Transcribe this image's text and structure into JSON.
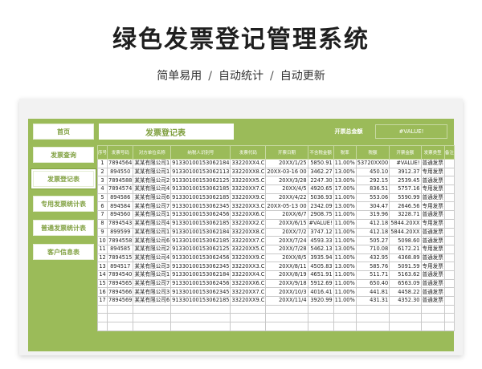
{
  "header": {
    "title": "绿色发票登记管理系统",
    "taglines": [
      "简单易用",
      "自动统计",
      "自动更新"
    ],
    "separator": "/"
  },
  "nav": [
    {
      "label": "首页",
      "active": false
    },
    {
      "label": "发票查询",
      "active": false
    },
    {
      "label": "发票登记表",
      "active": true
    },
    {
      "label": "专用发票统计表",
      "active": false
    },
    {
      "label": "普通发票统计表",
      "active": false
    },
    {
      "label": "客户信息表",
      "active": false
    }
  ],
  "sheet": {
    "title": "发票登记表",
    "summary_label": "开票总金额",
    "summary_value": "#VALUE!"
  },
  "table": {
    "columns": [
      "序号",
      "发票号码",
      "对方单位名称",
      "纳税人识别号",
      "发票代码",
      "开票日期",
      "不含税金额",
      "税率",
      "税额",
      "开票金额",
      "发票类型",
      "备注"
    ],
    "rows": [
      [
        "1",
        "7894564",
        "某某有限公司1",
        "91330100153062184",
        "33220XX4.C",
        "20XX/1/25",
        "5850.91",
        "11.00%",
        "53720XX00",
        "#VALUE!",
        "普通发票",
        ""
      ],
      [
        "2",
        "894550",
        "某某有限公司1",
        "91330100153062113",
        "33220XX8.C",
        "20XX-03-16 00",
        "3462.27",
        "13.00%",
        "450.10",
        "3912.37",
        "专用发票",
        ""
      ],
      [
        "3",
        "7894588",
        "某某有限公司2",
        "91330100153062125",
        "33220XX5.C",
        "20XX/3/28",
        "2247.30",
        "13.00%",
        "292.15",
        "2539.45",
        "普通发票",
        ""
      ],
      [
        "4",
        "7894574",
        "某某有限公司4",
        "91330100153062185",
        "33220XX7.C",
        "20XX/4/5",
        "4920.65",
        "17.00%",
        "836.51",
        "5757.16",
        "专用发票",
        ""
      ],
      [
        "5",
        "894586",
        "某某有限公司6",
        "91330100153062185",
        "33220XX9.C",
        "20XX/4/22",
        "5036.93",
        "11.00%",
        "553.06",
        "5590.99",
        "普通发票",
        ""
      ],
      [
        "6",
        "894584",
        "某某有限公司7",
        "91330100153062345",
        "33220XX3.C",
        "20XX-05-13 00",
        "2342.09",
        "13.00%",
        "304.47",
        "2646.56",
        "专用发票",
        ""
      ],
      [
        "7",
        "894560",
        "某某有限公司1",
        "91330100153062456",
        "33220XX6.C",
        "20XX/6/7",
        "2908.75",
        "11.00%",
        "319.96",
        "3228.71",
        "普通发票",
        ""
      ],
      [
        "8",
        "7894543",
        "某某有限公司4",
        "91330100153062185",
        "33220XX2.C",
        "20XX/6/15",
        "#VALUE!",
        "11.00%",
        "412.18",
        "5844.20XX",
        "专用发票",
        ""
      ],
      [
        "9",
        "899599",
        "某某有限公司1",
        "91330100153062184",
        "33220XX8.C",
        "20XX/7/2",
        "3747.12",
        "11.00%",
        "412.18",
        "5844.20XX",
        "普通发票",
        ""
      ],
      [
        "10",
        "7894558",
        "某某有限公司6",
        "91330100153062185",
        "33220XX7.C",
        "20XX/7/24",
        "4593.33",
        "11.00%",
        "505.27",
        "5098.60",
        "普通发票",
        ""
      ],
      [
        "11",
        "894585",
        "某某有限公司2",
        "91330100153062125",
        "33220XX5.C",
        "20XX/7/28",
        "5462.13",
        "13.00%",
        "710.08",
        "6172.21",
        "专用发票",
        ""
      ],
      [
        "12",
        "7894515",
        "某某有限公司4",
        "91330100153062456",
        "33220XX9.C",
        "20XX/8/5",
        "3935.94",
        "11.00%",
        "432.95",
        "4368.89",
        "普通发票",
        ""
      ],
      [
        "13",
        "894517",
        "某某有限公司3",
        "91330100153062345",
        "33220XX3.C",
        "20XX/8/11",
        "4505.83",
        "13.00%",
        "585.76",
        "5091.59",
        "专用发票",
        ""
      ],
      [
        "14",
        "7894540",
        "某某有限公司1",
        "91330100153062184",
        "33220XX4.C",
        "20XX/8/19",
        "4651.91",
        "11.00%",
        "511.71",
        "5163.62",
        "普通发票",
        ""
      ],
      [
        "15",
        "7894565",
        "某某有限公司7",
        "91330100153062456",
        "33220XX6.C",
        "20XX/9/18",
        "5912.69",
        "11.00%",
        "650.40",
        "6563.09",
        "普通发票",
        ""
      ],
      [
        "16",
        "7894566",
        "某某有限公司3",
        "91330100153062345",
        "33220XX7.C",
        "20XX/10/3",
        "4016.41",
        "11.00%",
        "441.81",
        "4458.22",
        "普通发票",
        ""
      ],
      [
        "17",
        "7894569",
        "某某有限公司6",
        "91330100153062185",
        "33220XX9.C",
        "20XX/11/4",
        "3920.99",
        "11.00%",
        "431.31",
        "4352.30",
        "普通发票",
        ""
      ]
    ],
    "blank_rows": 3
  }
}
